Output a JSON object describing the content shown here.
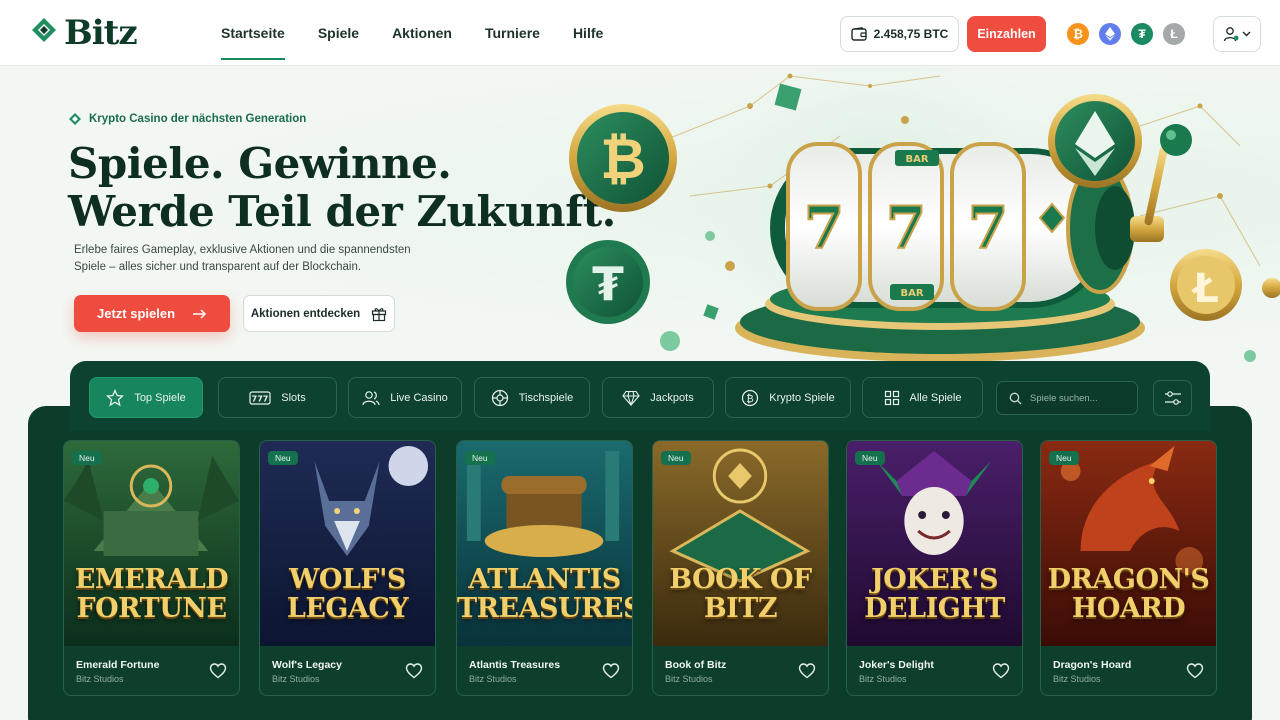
{
  "brand": {
    "name": "Bitz"
  },
  "nav": [
    {
      "label": "Startseite",
      "active": true
    },
    {
      "label": "Spiele"
    },
    {
      "label": "Aktionen"
    },
    {
      "label": "Turniere"
    },
    {
      "label": "Hilfe"
    }
  ],
  "wallet": {
    "balance": "2.458,75 BTC"
  },
  "deposit_label": "Einzahlen",
  "coins": [
    {
      "icon": "bitcoin-icon",
      "color": "#f7931a"
    },
    {
      "icon": "ethereum-icon",
      "color": "#627eea"
    },
    {
      "icon": "tether-icon",
      "color": "#1a8a63"
    },
    {
      "icon": "litecoin-icon",
      "color": "#a6a9aa"
    }
  ],
  "hero": {
    "tagline": "Krypto Casino der nächsten Generation",
    "headline_1": "Spiele. Gewinne.",
    "headline_2": "Werde Teil der Zukunft.",
    "subtext": "Erlebe faires Gameplay, exklusive Aktionen und die spannendsten Spiele – alles sicher und transparent auf der Blockchain.",
    "cta_primary": "Jetzt spielen",
    "cta_secondary": "Aktionen entdecken"
  },
  "tabs": [
    {
      "label": "Top Spiele",
      "icon": "star-icon",
      "active": true
    },
    {
      "label": "Slots",
      "icon": "slots-777-icon"
    },
    {
      "label": "Live Casino",
      "icon": "live-dealer-icon"
    },
    {
      "label": "Tischspiele",
      "icon": "roulette-icon"
    },
    {
      "label": "Jackpots",
      "icon": "diamond-icon"
    },
    {
      "label": "Krypto Spiele",
      "icon": "crypto-coin-icon"
    },
    {
      "label": "Alle Spiele",
      "icon": "grid-icon"
    }
  ],
  "search": {
    "placeholder": "Spiele suchen..."
  },
  "games": [
    {
      "title": "Emerald Fortune",
      "art_line1": "EMERALD",
      "art_line2": "FORTUNE",
      "studio": "Bitz Studios",
      "badge": "Neu"
    },
    {
      "title": "Wolf's Legacy",
      "art_line1": "WOLF'S",
      "art_line2": "LEGACY",
      "studio": "Bitz Studios",
      "badge": "Neu"
    },
    {
      "title": "Atlantis Treasures",
      "art_line1": "ATLANTIS",
      "art_line2": "TREASURES",
      "studio": "Bitz Studios",
      "badge": "Neu"
    },
    {
      "title": "Book of Bitz",
      "art_line1": "BOOK OF",
      "art_line2": "BITZ",
      "studio": "Bitz Studios",
      "badge": "Neu"
    },
    {
      "title": "Joker's Delight",
      "art_line1": "JOKER'S",
      "art_line2": "DELIGHT",
      "studio": "Bitz Studios",
      "badge": "Neu"
    },
    {
      "title": "Dragon's Hoard",
      "art_line1": "DRAGON'S",
      "art_line2": "HOARD",
      "studio": "Bitz Studios",
      "badge": "Neu"
    }
  ]
}
